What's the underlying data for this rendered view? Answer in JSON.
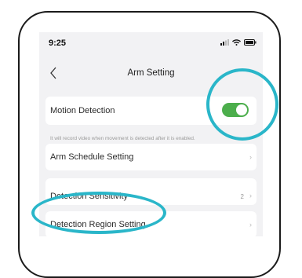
{
  "status_bar": {
    "time": "9:25"
  },
  "nav": {
    "title": "Arm Setting",
    "back_icon": "chevron-left-icon"
  },
  "motion_detection": {
    "label": "Motion Detection",
    "enabled": true,
    "hint": "It will record video when movement is detected after it is enabled."
  },
  "settings": [
    {
      "label": "Arm Schedule Setting",
      "value": ""
    },
    {
      "label": "Detection Sensitivity",
      "value": "2"
    },
    {
      "label": "Detection Region Setting",
      "value": ""
    }
  ],
  "colors": {
    "toggle_on": "#4cae4c",
    "highlight": "#2ab6c9"
  }
}
